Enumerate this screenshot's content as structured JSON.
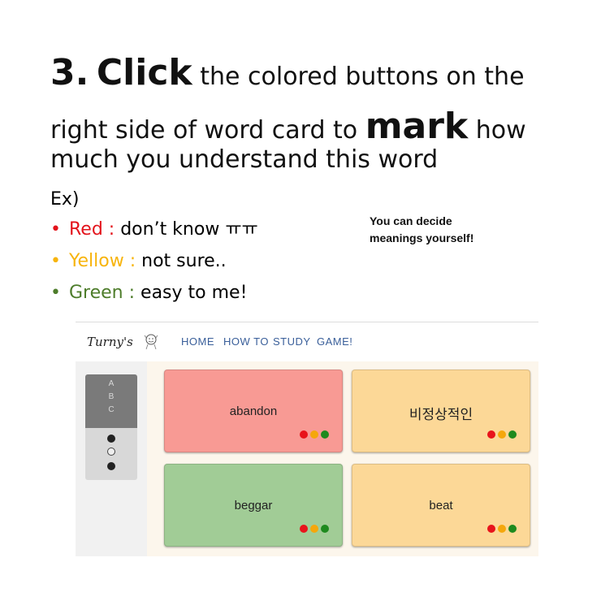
{
  "heading": {
    "line1_number": "3.",
    "line1_big": "Click",
    "line1_rest": "the colored buttons on the",
    "line2_start": "right side of word card to",
    "line2_big": "mark",
    "line2_rest": "how",
    "line3": "much you understand this word"
  },
  "example_label": "Ex)",
  "bullets": [
    {
      "key": "Red :",
      "desc": "don’t know ㅠㅠ",
      "color": "#e3131b"
    },
    {
      "key": "Yellow :",
      "desc": "not sure..",
      "color": "#f7b40c"
    },
    {
      "key": "Green :",
      "desc": "easy to me!",
      "color": "#4d7c2a"
    }
  ],
  "bullet_glyph": "•",
  "note": {
    "line1": "You can decide",
    "line2": "meanings yourself!"
  },
  "app": {
    "logo": "Turny's",
    "logo_icon": "doodle-face-icon",
    "nav": [
      "HOME",
      "HOW TO",
      "STUDY",
      "GAME!"
    ],
    "sidebar_letters": [
      "A",
      "B",
      "C"
    ],
    "sidebar_radios": [
      "filled",
      "empty",
      "filled"
    ],
    "mark_colors": {
      "red": "#e8141b",
      "yellow": "#f5a70b",
      "green": "#1e8a1e"
    },
    "cards": [
      {
        "word": "abandon",
        "bg": "#f89a94"
      },
      {
        "word": "비정상적인",
        "bg": "#fcd897"
      },
      {
        "word": "beggar",
        "bg": "#a1cc96"
      },
      {
        "word": "beat",
        "bg": "#fcd897"
      }
    ]
  }
}
